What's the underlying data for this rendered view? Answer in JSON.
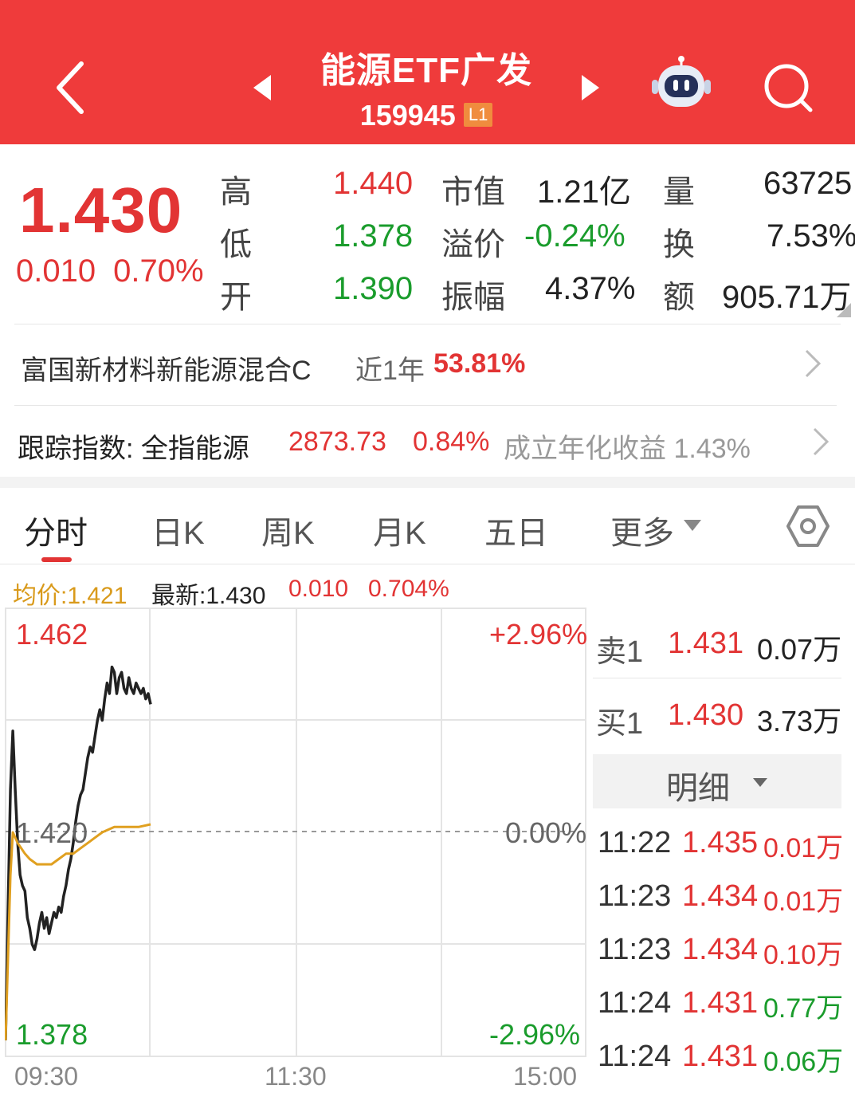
{
  "header": {
    "title": "能源ETF广发",
    "code": "159945",
    "level_badge": "L1",
    "colors": {
      "background": "#ef3b3b"
    }
  },
  "quote": {
    "price": "1.430",
    "change": "0.010",
    "change_pct": "0.70%",
    "high_label": "高",
    "high": "1.440",
    "low_label": "低",
    "low": "1.378",
    "open_label": "开",
    "open": "1.390",
    "mktcap_label": "市值",
    "mktcap": "1.21亿",
    "premium_label": "溢价",
    "premium": "-0.24%",
    "amplitude_label": "振幅",
    "amplitude": "4.37%",
    "volume_label": "量",
    "volume": "63725",
    "turnover_label": "换",
    "turnover": "7.53%",
    "amount_label": "额",
    "amount": "905.71万"
  },
  "fund": {
    "name": "富国新材料新能源混合C",
    "period": "近1年",
    "return": "53.81%"
  },
  "index": {
    "label": "跟踪指数: 全指能源",
    "value": "2873.73",
    "change_pct": "0.84%",
    "annual_label": "成立年化收益",
    "annual": "1.43%"
  },
  "tabs": [
    "分时",
    "日K",
    "周K",
    "月K",
    "五日",
    "更多"
  ],
  "legend": {
    "avg_label": "均价:",
    "avg": "1.421",
    "last_label": "最新:",
    "last": "1.430",
    "change": "0.010",
    "change_pct": "0.704%"
  },
  "chart_data": {
    "type": "line",
    "x_ticks": [
      "09:30",
      "11:30",
      "15:00"
    ],
    "y_top": "1.462",
    "y_mid": "1.420",
    "y_bottom": "1.378",
    "pct_top": "+2.96%",
    "pct_mid": "0.00%",
    "pct_bottom": "-2.96%",
    "ylim": [
      1.378,
      1.462
    ],
    "session_minutes": 240,
    "series": [
      {
        "color": "#222222",
        "points": [
          [
            0,
            1.381
          ],
          [
            1,
            1.405
          ],
          [
            2,
            1.428
          ],
          [
            3,
            1.439
          ],
          [
            4,
            1.428
          ],
          [
            5,
            1.418
          ],
          [
            6,
            1.412
          ],
          [
            7,
            1.41
          ],
          [
            8,
            1.409
          ],
          [
            9,
            1.404
          ],
          [
            10,
            1.402
          ],
          [
            11,
            1.399
          ],
          [
            12,
            1.398
          ],
          [
            13,
            1.4
          ],
          [
            14,
            1.403
          ],
          [
            15,
            1.405
          ],
          [
            16,
            1.402
          ],
          [
            17,
            1.404
          ],
          [
            18,
            1.401
          ],
          [
            19,
            1.403
          ],
          [
            20,
            1.405
          ],
          [
            21,
            1.404
          ],
          [
            22,
            1.406
          ],
          [
            23,
            1.405
          ],
          [
            24,
            1.408
          ],
          [
            25,
            1.41
          ],
          [
            26,
            1.413
          ],
          [
            27,
            1.415
          ],
          [
            28,
            1.418
          ],
          [
            29,
            1.422
          ],
          [
            30,
            1.425
          ],
          [
            31,
            1.427
          ],
          [
            32,
            1.428
          ],
          [
            33,
            1.431
          ],
          [
            34,
            1.434
          ],
          [
            35,
            1.436
          ],
          [
            36,
            1.435
          ],
          [
            37,
            1.438
          ],
          [
            38,
            1.441
          ],
          [
            39,
            1.443
          ],
          [
            40,
            1.441
          ],
          [
            41,
            1.445
          ],
          [
            42,
            1.448
          ],
          [
            43,
            1.446
          ],
          [
            44,
            1.451
          ],
          [
            45,
            1.45
          ],
          [
            46,
            1.446
          ],
          [
            47,
            1.449
          ],
          [
            48,
            1.45
          ],
          [
            49,
            1.447
          ],
          [
            50,
            1.446
          ],
          [
            51,
            1.449
          ],
          [
            52,
            1.447
          ],
          [
            53,
            1.446
          ],
          [
            54,
            1.448
          ],
          [
            55,
            1.447
          ],
          [
            56,
            1.446
          ],
          [
            57,
            1.447
          ],
          [
            58,
            1.445
          ],
          [
            59,
            1.446
          ],
          [
            60,
            1.444
          ]
        ]
      },
      {
        "color": "#e0a020",
        "points": [
          [
            0,
            1.381
          ],
          [
            2,
            1.412
          ],
          [
            3,
            1.42
          ],
          [
            5,
            1.418
          ],
          [
            8,
            1.416
          ],
          [
            10,
            1.415
          ],
          [
            13,
            1.414
          ],
          [
            16,
            1.414
          ],
          [
            19,
            1.414
          ],
          [
            22,
            1.415
          ],
          [
            25,
            1.416
          ],
          [
            28,
            1.416
          ],
          [
            31,
            1.417
          ],
          [
            34,
            1.418
          ],
          [
            37,
            1.419
          ],
          [
            40,
            1.42
          ],
          [
            45,
            1.421
          ],
          [
            50,
            1.421
          ],
          [
            55,
            1.421
          ],
          [
            60,
            1.4215
          ]
        ]
      }
    ]
  },
  "orderbook": {
    "sell_label": "卖1",
    "sell_price": "1.431",
    "sell_vol": "0.07万",
    "buy_label": "买1",
    "buy_price": "1.430",
    "buy_vol": "3.73万",
    "detail_label": "明细",
    "trades": [
      {
        "time": "11:22",
        "price": "1.435",
        "vol": "0.01万",
        "vol_color": "#e23434"
      },
      {
        "time": "11:23",
        "price": "1.434",
        "vol": "0.01万",
        "vol_color": "#e23434"
      },
      {
        "time": "11:23",
        "price": "1.434",
        "vol": "0.10万",
        "vol_color": "#e23434"
      },
      {
        "time": "11:24",
        "price": "1.431",
        "vol": "0.77万",
        "vol_color": "#1a9c2c"
      },
      {
        "time": "11:24",
        "price": "1.431",
        "vol": "0.06万",
        "vol_color": "#1a9c2c"
      }
    ]
  }
}
